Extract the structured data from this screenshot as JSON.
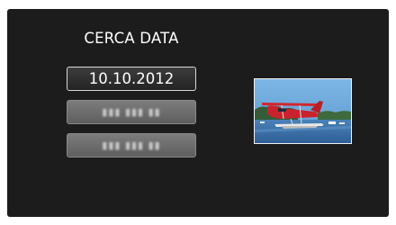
{
  "search": {
    "title": "CERCA DATA",
    "dates": [
      {
        "label": "10.10.2012",
        "state": "selected"
      },
      {
        "label": "▮▮▮ ▮▮▮ ▮▮",
        "state": "unavailable"
      },
      {
        "label": "▮▮▮ ▮▮▮ ▮▮",
        "state": "unavailable"
      }
    ]
  },
  "thumbnail": {
    "subject": "red seaplane on water",
    "colors": {
      "sky": "#6ea8da",
      "water": "#3d6fa8",
      "plane": "#c8232c",
      "trees": "#355c36"
    }
  }
}
